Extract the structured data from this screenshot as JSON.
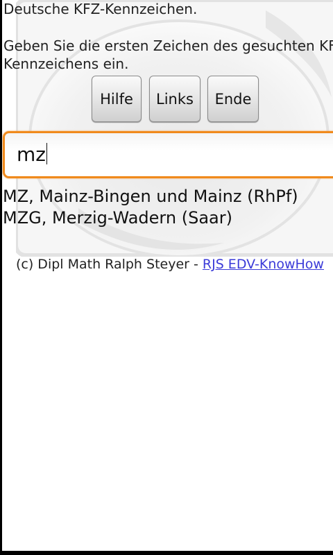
{
  "app": {
    "heading": "Deutsche KFZ-Kennzeichen.",
    "instruction": "Geben Sie die ersten Zeichen des gesuchten KFZ-Kennzeichens ein."
  },
  "buttons": {
    "help_label": "Hilfe",
    "links_label": "Links",
    "end_label": "Ende"
  },
  "search": {
    "value": "mz"
  },
  "results": [
    "MZ, Mainz-Bingen und Mainz (RhPf)",
    "MZG, Merzig-Wadern (Saar)"
  ],
  "footer": {
    "copyright": "(c) Dipl Math Ralph Steyer - ",
    "link_text": "RJS EDV-KnowHow"
  },
  "colors": {
    "focus_border": "#f08a1c",
    "link": "#3b3bd8",
    "background": "#ffffff"
  }
}
